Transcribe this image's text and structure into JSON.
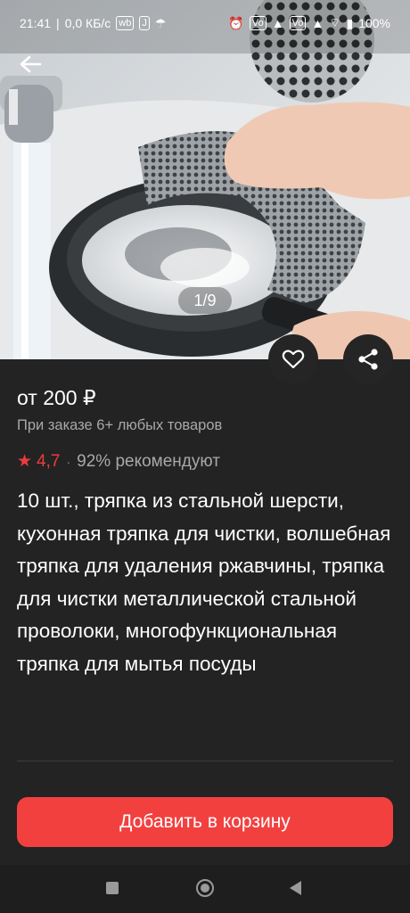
{
  "status_bar": {
    "time": "21:41",
    "network_speed": "0,0 КБ/с",
    "battery": "100%",
    "icons": [
      "wb-icon",
      "j-icon",
      "umbrella-icon",
      "alarm-icon",
      "volte-icon",
      "signal-4g-icon",
      "volte-icon",
      "signal-icon",
      "wifi-icon",
      "battery-icon"
    ]
  },
  "gallery": {
    "counter": "1/9",
    "image_subject": "steel-wire-cloth-washing-pan"
  },
  "actions": {
    "back_icon": "arrow-left-icon",
    "favorite_icon": "heart-outline-icon",
    "share_icon": "share-icon"
  },
  "product": {
    "price": "от 200 ₽",
    "price_note": "При заказе 6+ любых товаров",
    "rating": "4,7",
    "rating_separator": "·",
    "recommend": "92% рекомендуют",
    "title": "10 шт., тряпка из стальной шерсти, кухонная тряпка для чистки, волшебная тряпка для удаления ржавчины, тряпка для чистки металлической стальной проволоки, многофункциональная тряпка для мытья посуды"
  },
  "cart": {
    "button_label": "Добавить в корзину"
  },
  "colors": {
    "accent": "#f2403f",
    "background": "#232323",
    "rating": "#ee3b3b"
  }
}
